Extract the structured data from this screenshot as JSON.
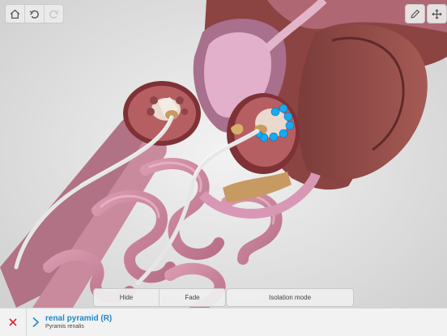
{
  "toolbar": {
    "left": [
      {
        "icon": "home-icon"
      },
      {
        "icon": "undo-icon"
      },
      {
        "icon": "redo-icon"
      }
    ],
    "right": [
      {
        "icon": "pencil-icon"
      },
      {
        "icon": "move-icon"
      }
    ]
  },
  "actions": {
    "hide": "Hide",
    "fade": "Fade",
    "isolation": "Isolation mode"
  },
  "selection": {
    "name": "renal pyramid (R)",
    "latin": "Pyramis renalis"
  },
  "colors": {
    "accent": "#1e88c9",
    "close": "#d8262a",
    "highlight": "#19a9ef"
  }
}
